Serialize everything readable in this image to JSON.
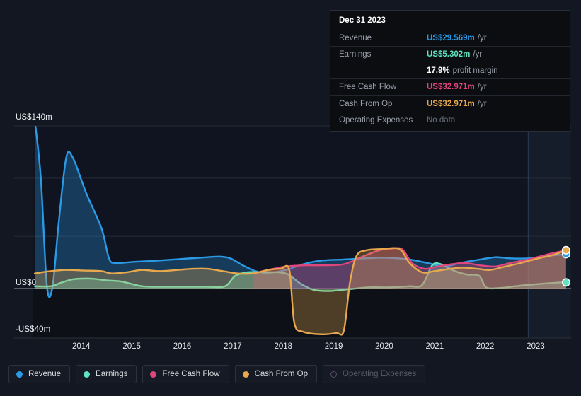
{
  "colors": {
    "background": "#131722",
    "revenue": "#2b9ae5",
    "earnings": "#5fe3c0",
    "free_cash_flow": "#e0457b",
    "cash_from_op": "#e8a84c",
    "operating_expenses": "#7d5ba6",
    "grid": "#262b36",
    "zero_line": "#9aa0ab",
    "text": "#e8eaed",
    "muted_text": "#9aa0ab"
  },
  "tooltip": {
    "title": "Dec 31 2023",
    "rows": [
      {
        "label": "Revenue",
        "value": "US$29.569m",
        "unit": "/yr",
        "color": "#2b9ae5"
      },
      {
        "label": "Earnings",
        "value": "US$5.302m",
        "unit": "/yr",
        "color": "#5fe3c0"
      },
      {
        "label": "",
        "value": "17.9%",
        "unit": "profit margin",
        "color": "#ffffff"
      },
      {
        "label": "Free Cash Flow",
        "value": "US$32.971m",
        "unit": "/yr",
        "color": "#e0457b"
      },
      {
        "label": "Cash From Op",
        "value": "US$32.971m",
        "unit": "/yr",
        "color": "#e8a84c"
      },
      {
        "label": "Operating Expenses",
        "value": "No data",
        "unit": "",
        "color": "#6b7280"
      }
    ]
  },
  "legend": [
    {
      "label": "Revenue",
      "color": "#2b9ae5",
      "enabled": true
    },
    {
      "label": "Earnings",
      "color": "#5fe3c0",
      "enabled": true
    },
    {
      "label": "Free Cash Flow",
      "color": "#e0457b",
      "enabled": true
    },
    {
      "label": "Cash From Op",
      "color": "#e8a84c",
      "enabled": true
    },
    {
      "label": "Operating Expenses",
      "color": "#7d5ba6",
      "enabled": false
    }
  ],
  "chart_data": {
    "type": "area",
    "title": "",
    "xlabel": "",
    "ylabel": "",
    "ylim": [
      -40,
      140
    ],
    "grid": true,
    "legend_position": "bottom",
    "y_ticks": [
      {
        "value": 140,
        "label": "US$140m"
      },
      {
        "value": 0,
        "label": "US$0"
      },
      {
        "value": -40,
        "label": "-US$40m"
      }
    ],
    "y_gridlines": [
      140,
      95,
      45,
      0
    ],
    "x_ticks": [
      "2014",
      "2015",
      "2016",
      "2017",
      "2018",
      "2019",
      "2020",
      "2021",
      "2022",
      "2023"
    ],
    "x_range": [
      2013.55,
      2024.2
    ],
    "forecast_boundary": 2023.35,
    "series": [
      {
        "name": "Revenue",
        "color": "#2b9ae5",
        "end_value": 29.569,
        "points": [
          [
            2013.58,
            145
          ],
          [
            2013.7,
            95
          ],
          [
            2013.82,
            2
          ],
          [
            2013.93,
            1
          ],
          [
            2014.05,
            55
          ],
          [
            2014.2,
            112
          ],
          [
            2014.33,
            113
          ],
          [
            2014.6,
            82
          ],
          [
            2014.9,
            52
          ],
          [
            2015.05,
            26
          ],
          [
            2015.18,
            22
          ],
          [
            2015.55,
            23
          ],
          [
            2016.0,
            24
          ],
          [
            2016.5,
            25.5
          ],
          [
            2017.0,
            27
          ],
          [
            2017.25,
            27.5
          ],
          [
            2017.45,
            26
          ],
          [
            2017.7,
            20
          ],
          [
            2017.95,
            15
          ],
          [
            2018.2,
            13.5
          ],
          [
            2018.55,
            16
          ],
          [
            2018.9,
            21
          ],
          [
            2019.25,
            24
          ],
          [
            2019.7,
            25
          ],
          [
            2020.1,
            26
          ],
          [
            2020.55,
            26.5
          ],
          [
            2021.0,
            25
          ],
          [
            2021.35,
            22
          ],
          [
            2021.7,
            19
          ],
          [
            2022.0,
            22
          ],
          [
            2022.4,
            25
          ],
          [
            2022.7,
            27
          ],
          [
            2023.0,
            26
          ],
          [
            2023.35,
            26
          ],
          [
            2023.7,
            28
          ],
          [
            2024.1,
            29.569
          ]
        ]
      },
      {
        "name": "Earnings",
        "color": "#5fe3c0",
        "end_value": 5.302,
        "points": [
          [
            2013.58,
            2
          ],
          [
            2013.9,
            2
          ],
          [
            2014.1,
            5
          ],
          [
            2014.35,
            8
          ],
          [
            2014.7,
            8.5
          ],
          [
            2015.0,
            7
          ],
          [
            2015.3,
            6
          ],
          [
            2015.7,
            2
          ],
          [
            2016.1,
            1.5
          ],
          [
            2016.6,
            1.5
          ],
          [
            2017.0,
            1.5
          ],
          [
            2017.35,
            2
          ],
          [
            2017.55,
            11
          ],
          [
            2017.8,
            14
          ],
          [
            2018.1,
            14
          ],
          [
            2018.4,
            14
          ],
          [
            2018.6,
            12
          ],
          [
            2018.85,
            4
          ],
          [
            2019.1,
            -1
          ],
          [
            2019.4,
            -2
          ],
          [
            2019.8,
            -0.5
          ],
          [
            2020.2,
            1
          ],
          [
            2020.6,
            1
          ],
          [
            2021.0,
            2
          ],
          [
            2021.25,
            3
          ],
          [
            2021.45,
            20
          ],
          [
            2021.62,
            21
          ],
          [
            2021.9,
            15
          ],
          [
            2022.15,
            12
          ],
          [
            2022.38,
            11
          ],
          [
            2022.52,
            1
          ],
          [
            2022.8,
            0.5
          ],
          [
            2023.1,
            2
          ],
          [
            2023.45,
            3.5
          ],
          [
            2023.9,
            5
          ],
          [
            2024.1,
            5.302
          ]
        ]
      },
      {
        "name": "Free Cash Flow",
        "color": "#e0457b",
        "end_value": 32.971,
        "points": [
          [
            2017.9,
            13
          ],
          [
            2018.2,
            16
          ],
          [
            2018.55,
            19
          ],
          [
            2018.9,
            20
          ],
          [
            2019.25,
            20
          ],
          [
            2019.7,
            21
          ],
          [
            2020.1,
            28
          ],
          [
            2020.4,
            33
          ],
          [
            2020.6,
            34
          ],
          [
            2020.85,
            34
          ],
          [
            2021.05,
            22
          ],
          [
            2021.3,
            17
          ],
          [
            2021.55,
            19
          ],
          [
            2021.85,
            21
          ],
          [
            2022.1,
            22
          ],
          [
            2022.4,
            20
          ],
          [
            2022.7,
            19
          ],
          [
            2023.0,
            22
          ],
          [
            2023.35,
            25
          ],
          [
            2023.7,
            29
          ],
          [
            2024.1,
            32.971
          ]
        ]
      },
      {
        "name": "Cash From Op",
        "color": "#e8a84c",
        "end_value": 32.971,
        "points": [
          [
            2013.58,
            13
          ],
          [
            2013.9,
            15
          ],
          [
            2014.2,
            16
          ],
          [
            2014.55,
            15.5
          ],
          [
            2014.9,
            15
          ],
          [
            2015.1,
            13
          ],
          [
            2015.4,
            14
          ],
          [
            2015.7,
            16
          ],
          [
            2016.05,
            15
          ],
          [
            2016.4,
            16
          ],
          [
            2016.7,
            17
          ],
          [
            2017.0,
            17
          ],
          [
            2017.3,
            15
          ],
          [
            2017.6,
            13
          ],
          [
            2017.9,
            13
          ],
          [
            2018.2,
            16
          ],
          [
            2018.45,
            17
          ],
          [
            2018.62,
            16
          ],
          [
            2018.72,
            -28
          ],
          [
            2018.9,
            -35
          ],
          [
            2019.25,
            -37
          ],
          [
            2019.55,
            -36
          ],
          [
            2019.7,
            -34
          ],
          [
            2019.82,
            5
          ],
          [
            2019.95,
            28
          ],
          [
            2020.15,
            33
          ],
          [
            2020.45,
            34
          ],
          [
            2020.8,
            34
          ],
          [
            2021.0,
            22
          ],
          [
            2021.25,
            14
          ],
          [
            2021.5,
            15
          ],
          [
            2021.8,
            17
          ],
          [
            2022.05,
            18
          ],
          [
            2022.35,
            17
          ],
          [
            2022.6,
            16
          ],
          [
            2022.9,
            19
          ],
          [
            2023.2,
            22
          ],
          [
            2023.55,
            26
          ],
          [
            2023.85,
            29
          ],
          [
            2024.1,
            32.971
          ]
        ]
      }
    ]
  }
}
